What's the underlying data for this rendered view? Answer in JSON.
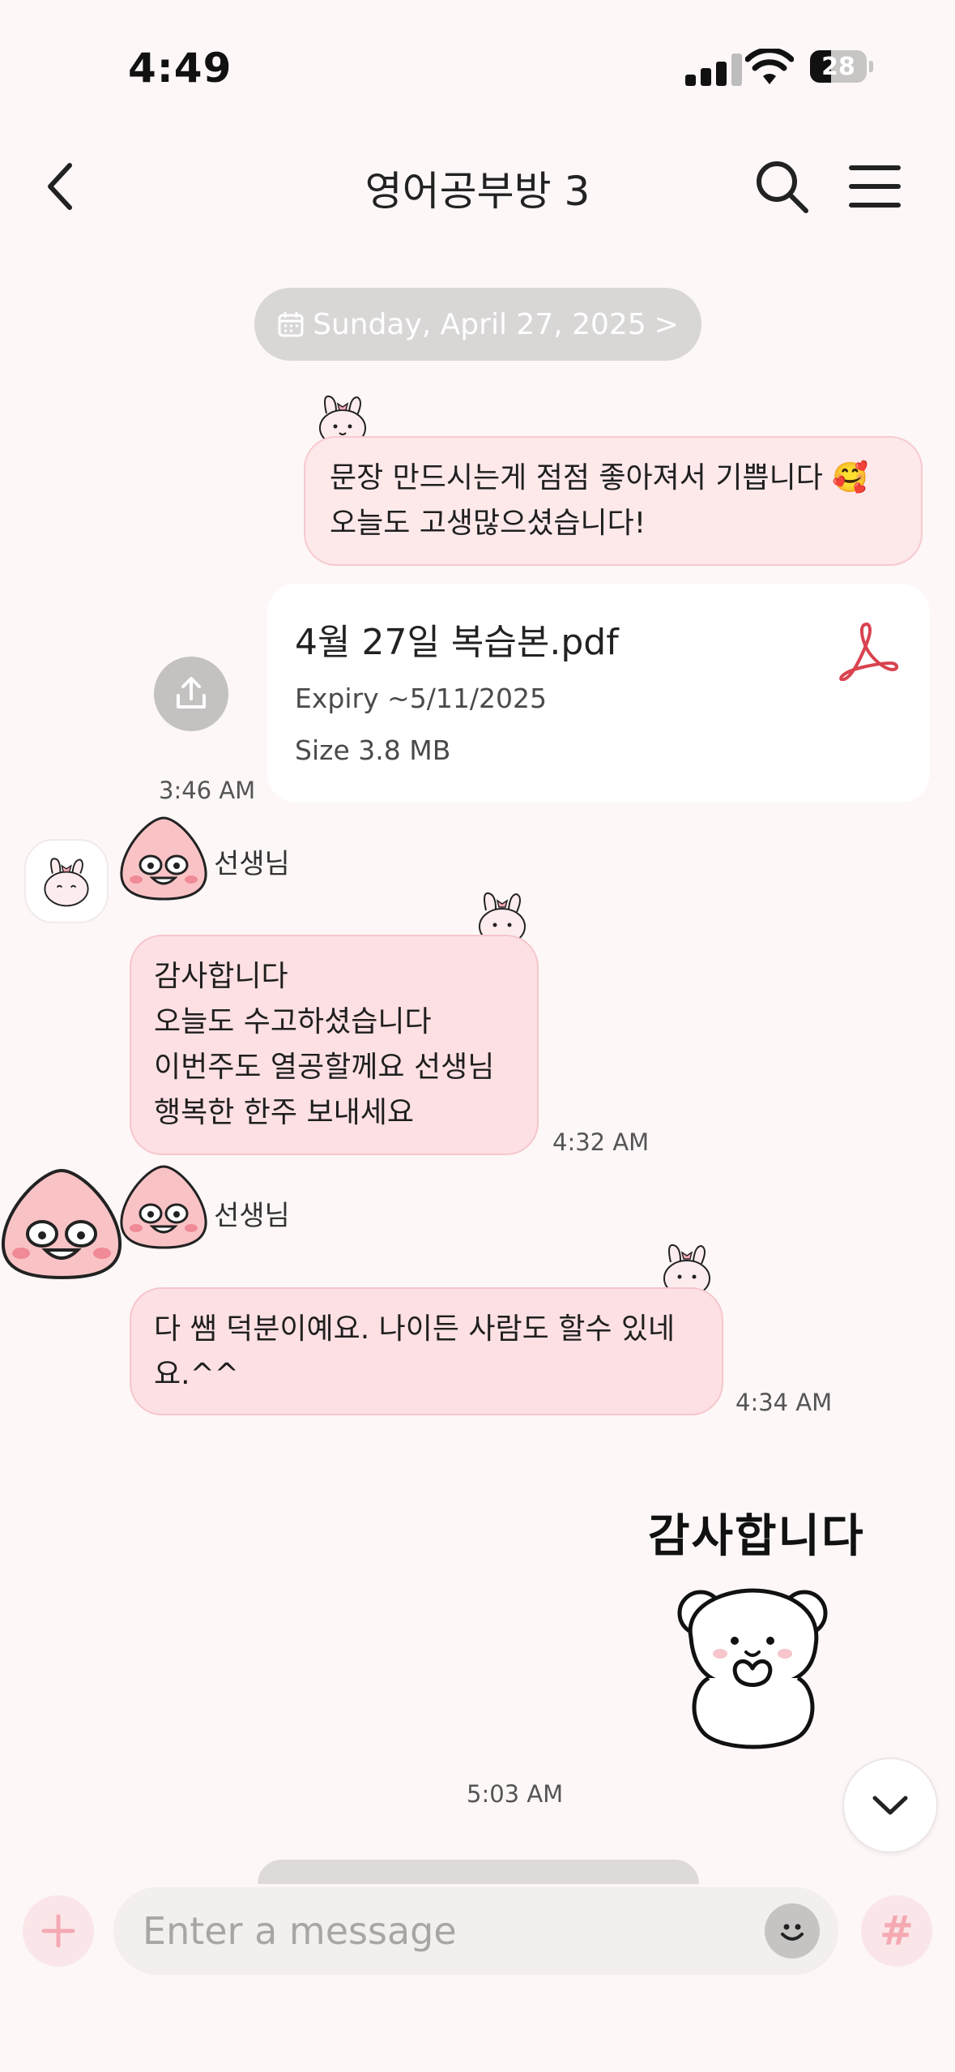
{
  "status_bar": {
    "time": "4:49",
    "battery": "28"
  },
  "header": {
    "title": "영어공부방 3"
  },
  "date_pill": {
    "label": "Sunday, April 27, 2025",
    "chevron": ">"
  },
  "messages": {
    "m1": {
      "lines": [
        "문장 만드시는게 점점 좋아져서 기쁩니다 🥰",
        "오늘도 고생많으셨습니다!"
      ]
    },
    "file": {
      "name": "4월 27일 복습본.pdf",
      "expiry_label": "Expiry",
      "expiry_value": "~5/11/2025",
      "size_label": "Size",
      "size_value": "3.8 MB",
      "time": "3:46 AM"
    },
    "m2": {
      "sender": "선생님",
      "lines": [
        "감사합니다",
        "오늘도 수고하셨습니다",
        "이번주도 열공할께요 선생님",
        "행복한 한주 보내세요"
      ],
      "time": "4:32 AM"
    },
    "m3": {
      "sender": "선생님",
      "lines": [
        "다 쌤 덕분이예요. 나이든 사람도 할수 있네",
        "요.^^"
      ],
      "time": "4:34 AM"
    },
    "sticker": {
      "text": "감사합니다",
      "time": "5:03 AM"
    }
  },
  "composer": {
    "placeholder": "Enter a message",
    "plus": "+",
    "hash": "#"
  },
  "colors": {
    "accent": "#f4a9b3",
    "bubble": "#fde0e3",
    "bubble_border": "#f5c6cc",
    "background": "#fdf7f7"
  },
  "icons": [
    "back-icon",
    "search-icon",
    "menu-icon",
    "calendar-icon",
    "pdf-icon",
    "upload-icon",
    "chevron-down-icon",
    "emoji-icon",
    "plus-icon",
    "hash-icon"
  ]
}
